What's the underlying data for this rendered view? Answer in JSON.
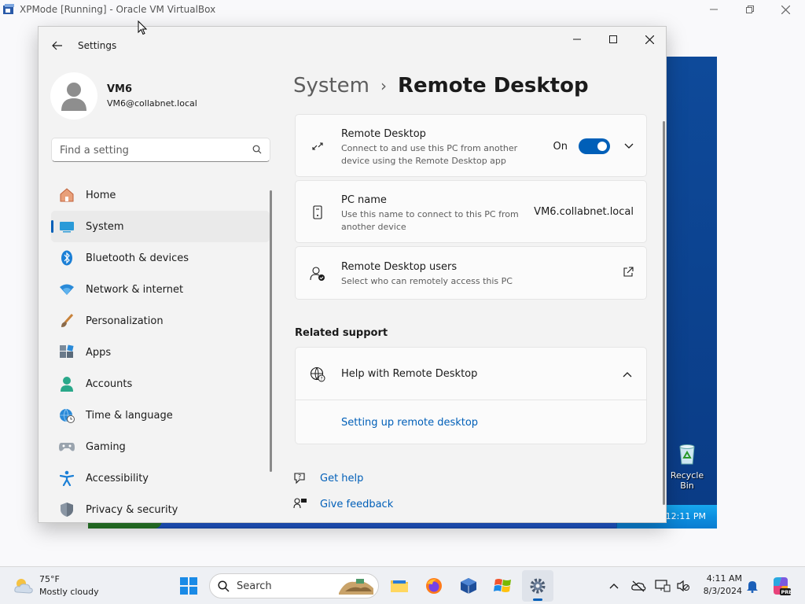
{
  "vbox": {
    "title": "XPMode [Running] - Oracle VM VirtualBox"
  },
  "xp": {
    "recycle_label": "Recycle Bin",
    "clock": "12:11 PM"
  },
  "settings": {
    "title": "Settings",
    "profile": {
      "name": "VM6",
      "email": "VM6@collabnet.local"
    },
    "search_placeholder": "Find a setting",
    "nav": [
      {
        "label": "Home",
        "icon": "home-icon"
      },
      {
        "label": "System",
        "icon": "system-icon",
        "selected": true
      },
      {
        "label": "Bluetooth & devices",
        "icon": "bluetooth-icon"
      },
      {
        "label": "Network & internet",
        "icon": "wifi-icon"
      },
      {
        "label": "Personalization",
        "icon": "brush-icon"
      },
      {
        "label": "Apps",
        "icon": "apps-icon"
      },
      {
        "label": "Accounts",
        "icon": "accounts-icon"
      },
      {
        "label": "Time & language",
        "icon": "globe-clock-icon"
      },
      {
        "label": "Gaming",
        "icon": "gamepad-icon"
      },
      {
        "label": "Accessibility",
        "icon": "accessibility-icon"
      },
      {
        "label": "Privacy & security",
        "icon": "shield-icon"
      }
    ],
    "breadcrumb": {
      "parent": "System",
      "separator": "›",
      "current": "Remote Desktop"
    },
    "remote_desktop": {
      "title": "Remote Desktop",
      "desc": "Connect to and use this PC from another device using the Remote Desktop app",
      "toggle_label": "On",
      "toggle_on": true
    },
    "pc_name": {
      "title": "PC name",
      "desc": "Use this name to connect to this PC from another device",
      "value": "VM6.collabnet.local"
    },
    "rd_users": {
      "title": "Remote Desktop users",
      "desc": "Select who can remotely access this PC"
    },
    "related_support": "Related support",
    "help": {
      "title": "Help with Remote Desktop",
      "link": "Setting up remote desktop"
    },
    "get_help": "Get help",
    "give_feedback": "Give feedback"
  },
  "taskbar": {
    "weather": {
      "temp": "75°F",
      "condition": "Mostly cloudy"
    },
    "search_label": "Search",
    "time": "4:11 AM",
    "date": "8/3/2024"
  },
  "colors": {
    "accent": "#005fb8",
    "xp_desktop": "#0d3f8c"
  }
}
